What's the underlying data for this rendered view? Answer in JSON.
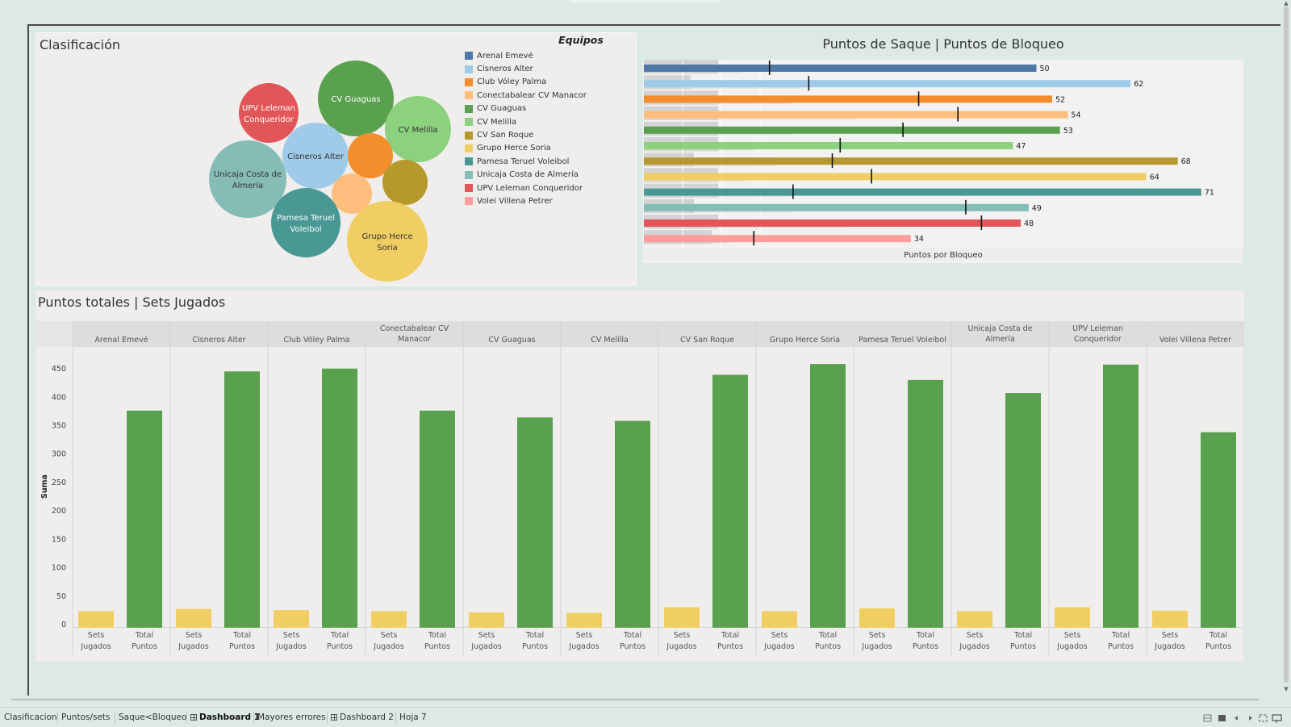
{
  "colors": {
    "teams": [
      "#4e79a7",
      "#a0cbe8",
      "#f28e2b",
      "#ffbe7d",
      "#59a14f",
      "#8cd17d",
      "#b6992d",
      "#f1ce63",
      "#499894",
      "#86bcb6",
      "#e15759",
      "#ff9d9a"
    ],
    "bar_sets": "#f1ce63",
    "bar_points": "#59a14f",
    "panel_bg": "#f0eeec"
  },
  "clasificacion": {
    "title": "Clasificación",
    "legend_title": "Equipos",
    "teams": [
      "Arenal Emevé",
      "Cisneros Alter",
      "Club Vóley Palma",
      "Conectabalear CV Manacor",
      "CV Guaguas",
      "CV Melilla",
      "CV San Roque",
      "Grupo Herce Soria",
      "Pamesa Teruel Voleibol",
      "Unicaja Costa de Almería",
      "UPV Leleman Conquerido​r",
      "Volei Villena Petrer"
    ],
    "bubbles": [
      {
        "team_index": 10,
        "label": [
          "UPV Leleman",
          "Conquerido​r"
        ]
      },
      {
        "team_index": 4,
        "label": [
          "CV Guaguas"
        ]
      },
      {
        "team_index": 5,
        "label": [
          "CV Melilla"
        ]
      },
      {
        "team_index": 1,
        "label": [
          "Cisneros Alter"
        ]
      },
      {
        "team_index": 2,
        "label": []
      },
      {
        "team_index": 9,
        "label": [
          "Unicaja Costa de",
          "Almería"
        ]
      },
      {
        "team_index": 3,
        "label": []
      },
      {
        "team_index": 6,
        "label": []
      },
      {
        "team_index": 8,
        "label": [
          "Pamesa Teruel",
          "Voleibol"
        ]
      },
      {
        "team_index": 7,
        "label": [
          "Grupo Herce",
          "Soria"
        ]
      }
    ]
  },
  "saque": {
    "title": "Puntos de Saque | Puntos de Bloqueo",
    "axis_label": "Puntos por Bloqueo",
    "values": [
      50,
      62,
      52,
      54,
      53,
      47,
      68,
      64,
      71,
      49,
      48,
      34
    ],
    "reference_marks": [
      16,
      21,
      35,
      40,
      33,
      25,
      24,
      29,
      19,
      41,
      43,
      14
    ]
  },
  "totales": {
    "title": "Puntos totales | Sets Jugados",
    "ylabel": "Suma",
    "sub_labels": [
      "Sets Jugados",
      "Total Puntos"
    ]
  },
  "chart_data": {
    "type": "bar",
    "title": "Puntos totales | Sets Jugados",
    "ylabel": "Suma",
    "xlabel": "",
    "ylim": [
      0,
      480
    ],
    "yticks": [
      0,
      50,
      100,
      150,
      200,
      250,
      300,
      350,
      400,
      450
    ],
    "categories": [
      "Arenal Emevé",
      "Cisneros Alter",
      "Club Vóley Palma",
      "Conectabalear CV Manacor",
      "CV Guaguas",
      "CV Melilla",
      "CV San Roque",
      "Grupo Herce Soria",
      "Pamesa Teruel Voleibol",
      "Unicaja Costa de Almería",
      "UPV Leleman Conquerido​r",
      "Volei Villena Petrer"
    ],
    "series": [
      {
        "name": "Sets Jugados",
        "values": [
          22,
          26,
          24,
          22,
          20,
          19,
          29,
          22,
          27,
          22,
          29,
          23
        ]
      },
      {
        "name": "Total Puntos",
        "values": [
          375,
          444,
          449,
          375,
          363,
          357,
          438,
          457,
          429,
          406,
          456,
          337
        ]
      }
    ]
  },
  "tabs": [
    {
      "label": "Clasificacion",
      "active": false,
      "icon": false
    },
    {
      "label": "Puntos/sets",
      "active": false,
      "icon": false
    },
    {
      "label": "Saque<Bloqueo",
      "active": false,
      "icon": false
    },
    {
      "label": "Dashboard 1",
      "active": true,
      "icon": true
    },
    {
      "label": "Mayores errores",
      "active": false,
      "icon": false
    },
    {
      "label": "Dashboard 2",
      "active": false,
      "icon": true
    },
    {
      "label": "Hoja 7",
      "active": false,
      "icon": false
    }
  ],
  "controls": [
    "grid-view-icon",
    "filmstrip-icon",
    "prev-icon",
    "next-icon",
    "fullscreen-icon",
    "present-icon"
  ]
}
